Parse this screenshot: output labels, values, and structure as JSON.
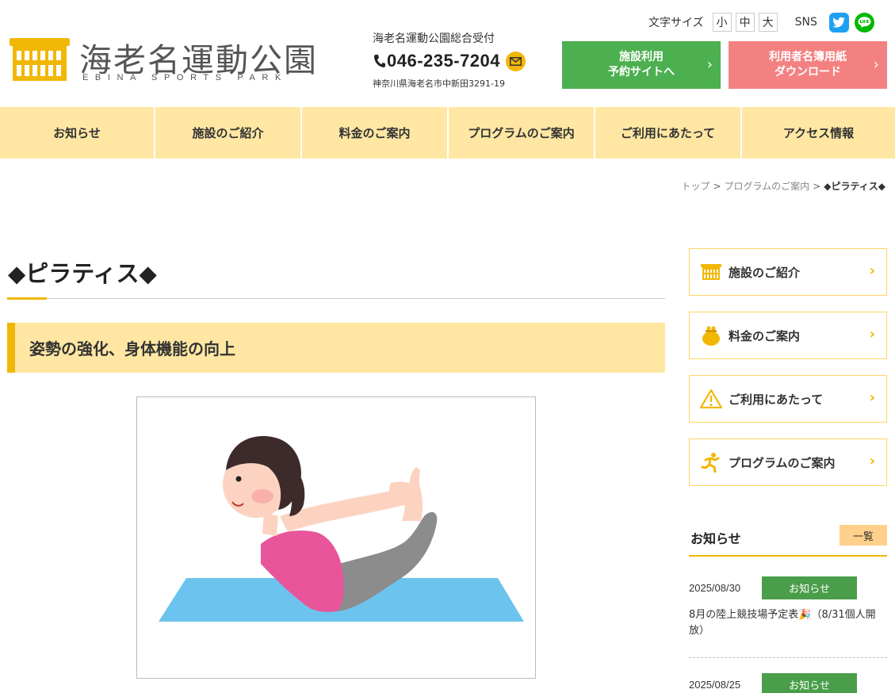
{
  "header": {
    "logo_title": "海老名運動公園",
    "logo_subtitle": "EBINA SPORTS PARK",
    "contact_title": "海老名運動公園総合受付",
    "phone": "046-235-7204",
    "address": "神奈川県海老名市中新田3291-19",
    "font_size_label": "文字サイズ",
    "font_sizes": [
      "小",
      "中",
      "大"
    ],
    "sns_label": "SNS",
    "reserve_button": "施設利用\n予約サイトへ",
    "download_button": "利用者名簿用紙\nダウンロード"
  },
  "nav": {
    "items": [
      "お知らせ",
      "施設のご紹介",
      "料金のご案内",
      "プログラムのご案内",
      "ご利用にあたって",
      "アクセス情報"
    ]
  },
  "breadcrumb": {
    "items": [
      "トップ",
      "プログラムのご案内"
    ],
    "current": "◆ピラティス◆",
    "separator": ">"
  },
  "main": {
    "page_title": "◆ピラティス◆",
    "section_heading": "姿勢の強化、身体機能の向上"
  },
  "sidebar": {
    "links": [
      "施設のご紹介",
      "料金のご案内",
      "ご利用にあたって",
      "プログラムのご案内"
    ],
    "chevron": "›",
    "news_title": "お知らせ",
    "news_more": "一覧",
    "news": [
      {
        "date": "2025/08/30",
        "category": "お知らせ",
        "text": "8月の陸上競技場予定表🎉（8/31個人開放）"
      },
      {
        "date": "2025/08/25",
        "category": "お知らせ",
        "text": ""
      }
    ]
  },
  "colors": {
    "accent_yellow": "#f2b705",
    "nav_bg": "#ffe7a3",
    "green": "#4caf50",
    "pink": "#f48181"
  }
}
